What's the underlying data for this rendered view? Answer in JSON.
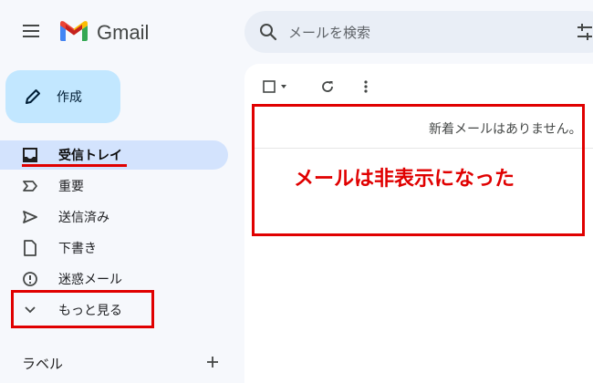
{
  "header": {
    "app_name": "Gmail",
    "search_placeholder": "メールを検索"
  },
  "compose": {
    "label": "作成"
  },
  "sidebar": {
    "items": [
      {
        "label": "受信トレイ",
        "icon": "inbox-icon",
        "active": true
      },
      {
        "label": "重要",
        "icon": "important-icon"
      },
      {
        "label": "送信済み",
        "icon": "send-icon"
      },
      {
        "label": "下書き",
        "icon": "draft-icon"
      },
      {
        "label": "迷惑メール",
        "icon": "spam-icon"
      },
      {
        "label": "もっと見る",
        "icon": "chevron-down-icon"
      }
    ],
    "labels_title": "ラベル"
  },
  "main": {
    "empty_message": "新着メールはありません。"
  },
  "annotation": {
    "note": "メールは非表示になった",
    "color": "#e00000"
  },
  "colors": {
    "background": "#f6f8fc",
    "compose_bg": "#c2e7ff",
    "active_bg": "#d3e3fd",
    "search_bg": "#e9eef6"
  }
}
